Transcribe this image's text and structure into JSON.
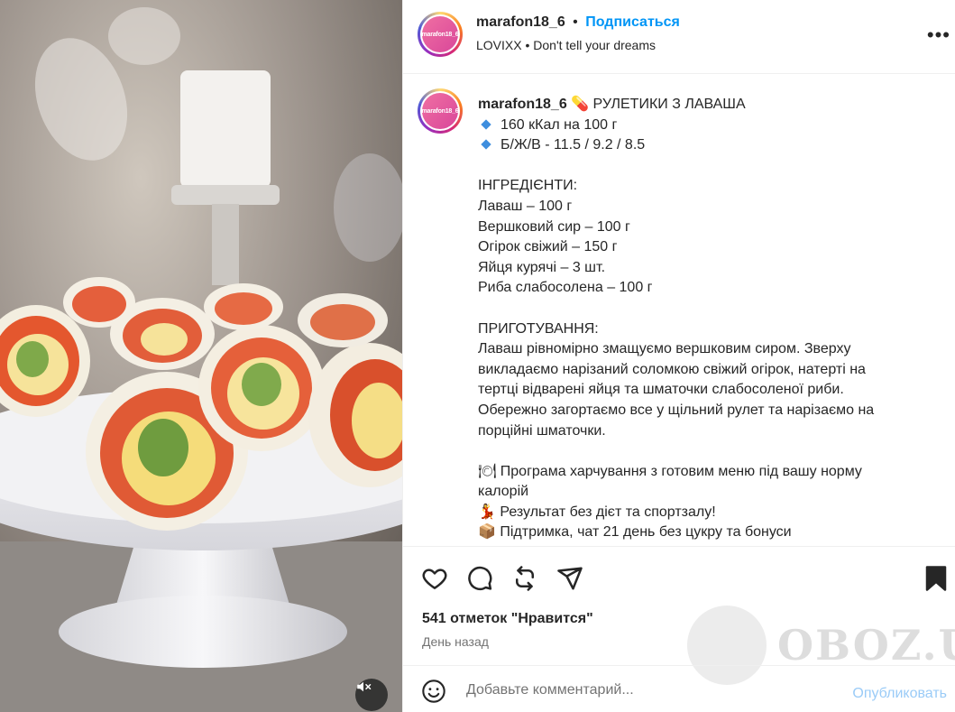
{
  "post": {
    "username": "marafon18_6",
    "avatar_text": "marafon18_6",
    "follow_label": "Подписаться",
    "audio": "LOVIXX",
    "audio_separator": "•",
    "song": "Don't tell your dreams",
    "more_label": "•••"
  },
  "caption": {
    "username": "marafon18_6",
    "title_emoji": "💊",
    "title": "РУЛЕТИКИ З ЛАВАША",
    "stats": [
      "160 кКал на 100 г",
      "Б/Ж/В - 11.5 / 9.2 / 8.5"
    ],
    "ingredients_header": "ІНГРЕДІЄНТИ:",
    "ingredients": [
      "Лаваш – 100 г",
      "Вершковий сир – 100 г",
      "Огірок свіжий – 150 г",
      "Яйця курячі – 3 шт.",
      "Риба слабосолена – 100 г"
    ],
    "cooking_header": "ПРИГОТУВАННЯ:",
    "cooking_lines": [
      "Лаваш рівномірно змащуємо вершковим сиром. Зверху",
      "викладаємо нарізаний соломкою свіжий огірок, натерті на",
      "тертці відварені яйця та шматочки слабосоленої риби.",
      "Обережно загортаємо все у щільний рулет та нарізаємо на",
      "порційні шматочки."
    ],
    "promo_lines": [
      {
        "emoji": "🍽",
        "text": "Програма харчування з готовим меню під вашу норму"
      },
      {
        "emoji": "",
        "text": "калорій"
      },
      {
        "emoji": "💃",
        "text": "Результат без дієт та спортзалу!"
      },
      {
        "emoji": "📦",
        "text": "Підтримка, чат 21 день без цукру та бонуси"
      }
    ]
  },
  "actions": {
    "like_icon": "heart-icon",
    "comment_icon": "comment-icon",
    "repost_icon": "repost-icon",
    "share_icon": "send-icon",
    "save_icon": "bookmark-icon"
  },
  "stats": {
    "likes": "541 отметок \"Нравится\"",
    "date": "День назад"
  },
  "comment": {
    "placeholder": "Добавьте комментарий...",
    "publish_label": "Опубликовать"
  },
  "watermark": {
    "text": "OBOZ.UA"
  },
  "colors": {
    "accent": "#0095f6",
    "publish_disabled": "#9acbf7",
    "text": "#262626",
    "muted": "#737373"
  }
}
